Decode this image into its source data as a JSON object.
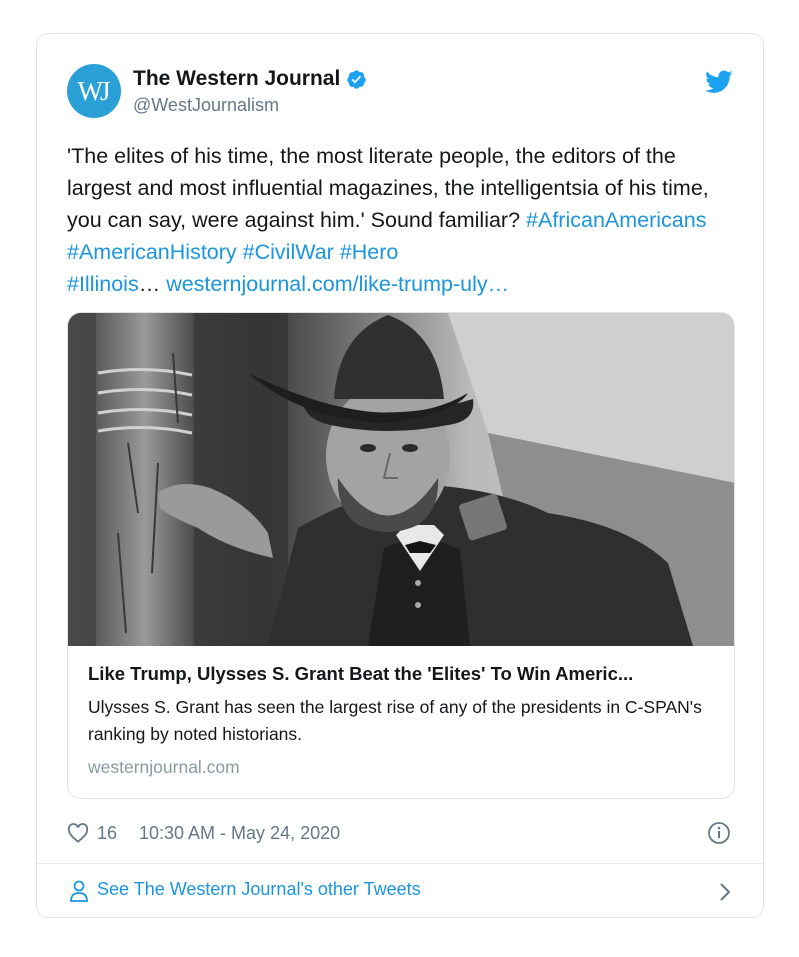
{
  "author": {
    "avatar_text": "WJ",
    "display_name": "The Western Journal",
    "handle": "@WestJournalism",
    "verified": true
  },
  "tweet": {
    "text": "'The elites of his time, the most literate people, the editors of the largest and most influential magazines, the intelligentsia of his time, you can say, were against him.' Sound familiar?",
    "hashtags": [
      "#AfricanAmericans",
      "#AmericanHistory",
      "#CivilWar",
      "#Hero",
      "#Illinois"
    ],
    "ellipsis": "…",
    "link": "westernjournal.com/like-trump-uly…"
  },
  "link_card": {
    "image_alt": "Black and white photo of Ulysses S. Grant leaning on a tree in military uniform and hat",
    "title": "Like Trump, Ulysses S. Grant Beat the 'Elites' To Win Americ...",
    "description": "Ulysses S. Grant has seen the largest rise of any of the presidents in C-SPAN's ranking by noted historians.",
    "domain": "westernjournal.com"
  },
  "meta": {
    "likes": "16",
    "timestamp": "10:30 AM - May 24, 2020"
  },
  "footer": {
    "label": "See The Western Journal's other Tweets"
  },
  "icons": {
    "verified": "verified-badge-icon",
    "twitter": "twitter-bird-icon",
    "like": "heart-icon",
    "info": "info-icon",
    "person": "person-icon",
    "chevron": "chevron-right-icon"
  },
  "colors": {
    "brand_blue": "#1da1f2",
    "link_blue": "#1b95e0",
    "avatar_bg": "#2aa0d6",
    "muted": "#657786",
    "border": "#dfe4e8"
  }
}
